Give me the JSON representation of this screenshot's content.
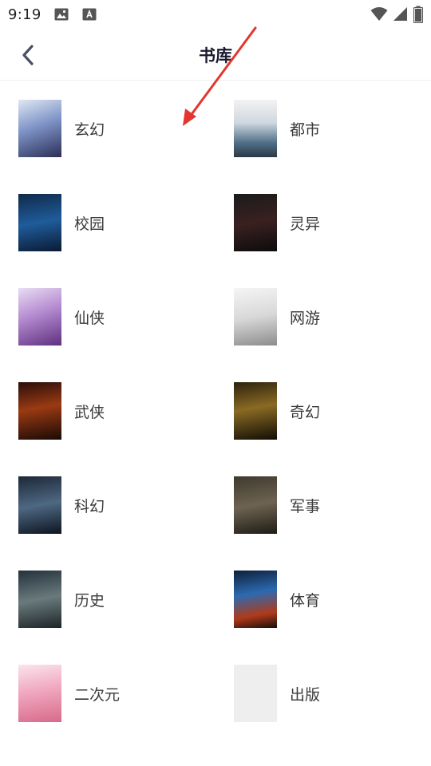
{
  "status_bar": {
    "time": "9:19"
  },
  "header": {
    "title": "书库"
  },
  "categories": [
    {
      "label": "玄幻",
      "cover_text": "",
      "cover_bg": "linear-gradient(160deg,#dfe7f3 0%,#7f95c8 45%,#2b2f57 100%)"
    },
    {
      "label": "都市",
      "cover_text": "",
      "cover_bg": "linear-gradient(180deg,#f2f2f2 0%,#cfd8e0 40%,#4f6f88 75%,#2b3a45 100%)"
    },
    {
      "label": "校园",
      "cover_text": "",
      "cover_bg": "linear-gradient(170deg,#0f2a4a 0%,#1f5c9a 50%,#0a1a33 100%)"
    },
    {
      "label": "灵异",
      "cover_text": "",
      "cover_bg": "linear-gradient(170deg,#1b1b1b 0%,#3a2020 50%,#0c0c0c 100%)"
    },
    {
      "label": "仙侠",
      "cover_text": "",
      "cover_bg": "linear-gradient(160deg,#e9ddf3 0%,#b48ad0 45%,#5e2f7e 100%)"
    },
    {
      "label": "网游",
      "cover_text": "",
      "cover_bg": "linear-gradient(170deg,#f5f5f5 0%,#d8d8d8 50%,#8c8c8c 100%)"
    },
    {
      "label": "武侠",
      "cover_text": "",
      "cover_bg": "linear-gradient(170deg,#2a0e0a 0%,#9a3a12 45%,#1a0a06 100%)"
    },
    {
      "label": "奇幻",
      "cover_text": "",
      "cover_bg": "linear-gradient(170deg,#2d220e 0%,#8a6a24 45%,#120e06 100%)"
    },
    {
      "label": "科幻",
      "cover_text": "",
      "cover_bg": "linear-gradient(170deg,#1c2838 0%,#4e6882 50%,#0d1520 100%)"
    },
    {
      "label": "军事",
      "cover_text": "",
      "cover_bg": "linear-gradient(170deg,#3f3a2e 0%,#6d6350 50%,#1f1c16 100%)"
    },
    {
      "label": "历史",
      "cover_text": "",
      "cover_bg": "linear-gradient(170deg,#24323c 0%,#6a7a7c 50%,#1d2528 100%)"
    },
    {
      "label": "体育",
      "cover_text": "",
      "cover_bg": "linear-gradient(170deg,#0e1f3a 0%,#2c6ab0 40%,#b03a1a 75%,#1a0e0a 100%)"
    },
    {
      "label": "二次元",
      "cover_text": "",
      "cover_bg": "linear-gradient(170deg,#fbe4ec 0%,#f0a8c0 45%,#d86a8a 100%)"
    },
    {
      "label": "出版",
      "cover_text": "",
      "cover_bg": "#eeeeee"
    }
  ],
  "colors": {
    "arrow": "#e2362f",
    "title": "#1a1a2e",
    "label": "#3a3a3a",
    "divider": "#eeeeee"
  }
}
